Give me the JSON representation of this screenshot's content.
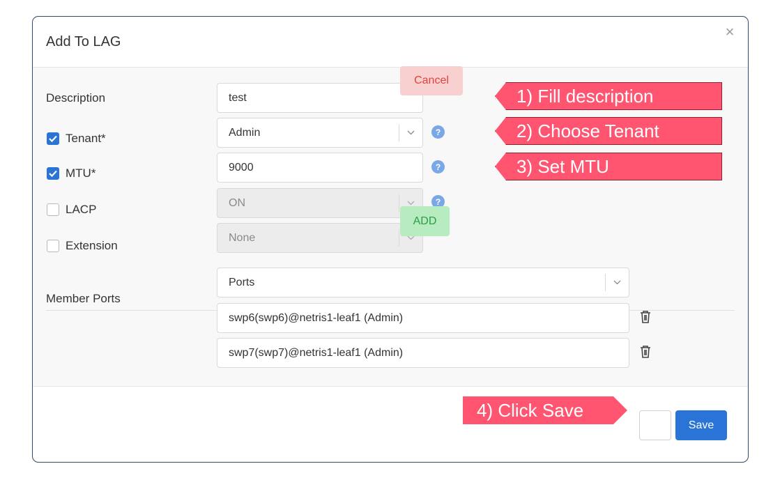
{
  "modal": {
    "title": "Add To LAG",
    "close_icon": "close-icon"
  },
  "form": {
    "description_label": "Description",
    "description_value": "test",
    "cancel_label": "Cancel",
    "tenant_label": "Tenant*",
    "tenant_checked": true,
    "tenant_value": "Admin",
    "mtu_label": "MTU*",
    "mtu_checked": true,
    "mtu_value": "9000",
    "lacp_label": "LACP",
    "lacp_checked": false,
    "lacp_value": "ON",
    "extension_label": "Extension",
    "extension_checked": false,
    "extension_value": "None",
    "add_label": "ADD",
    "member_ports_label": "Member Ports",
    "ports_placeholder": "Ports",
    "ports": [
      "swp6(swp6)@netris1-leaf1 (Admin)",
      "swp7(swp7)@netris1-leaf1 (Admin)"
    ]
  },
  "footer": {
    "save_label": "Save"
  },
  "annotations": {
    "step1": "1) Fill description",
    "step2": "2) Choose Tenant",
    "step3": "3) Set MTU",
    "step4": "4) Click Save"
  },
  "colors": {
    "primary": "#2a74d8",
    "callout": "#ff5570",
    "cancel_bg": "#f9d0d0",
    "add_bg": "#b6ecc0"
  }
}
